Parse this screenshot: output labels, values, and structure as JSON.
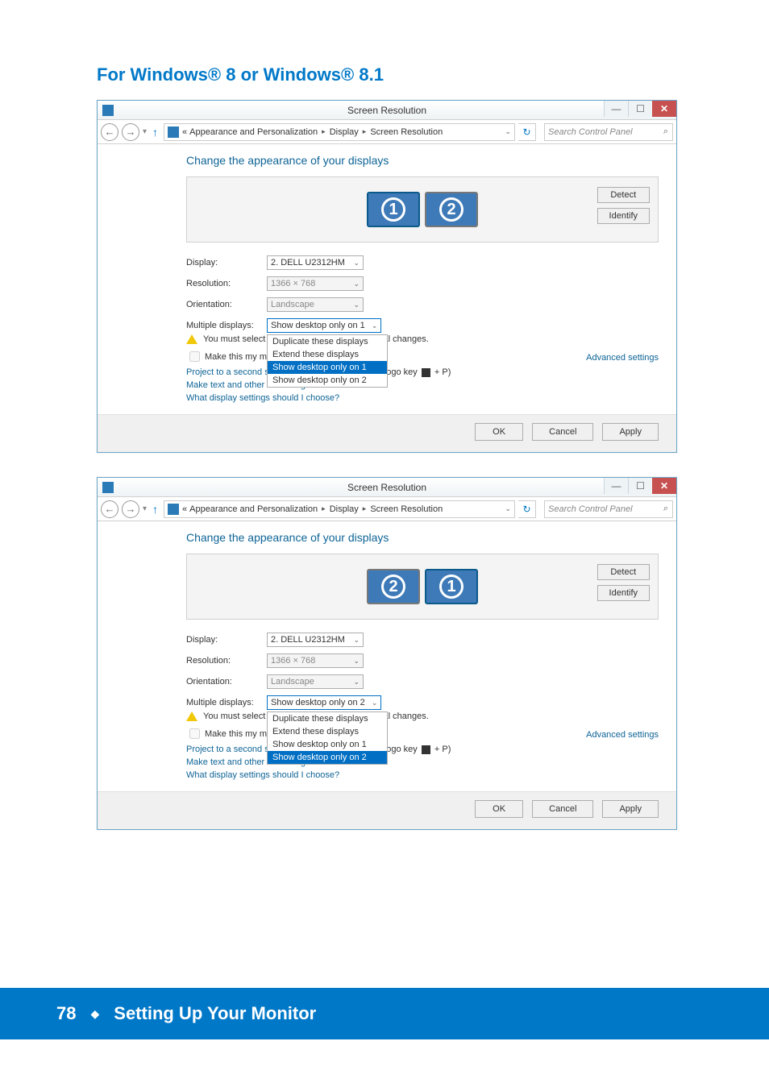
{
  "heading": "For Windows® 8 or Windows® 8.1",
  "footer": {
    "page": "78",
    "section": "Setting Up Your Monitor"
  },
  "common": {
    "title": "Screen Resolution",
    "breadcrumb": {
      "l1": "Appearance and Personalization",
      "l2": "Display",
      "l3": "Screen Resolution"
    },
    "search_placeholder": "Search Control Panel",
    "section_title": "Change the appearance of your displays",
    "detect": "Detect",
    "identify": "Identify",
    "labels": {
      "display": "Display:",
      "resolution": "Resolution:",
      "orientation": "Orientation:",
      "multiple": "Multiple displays:"
    },
    "values": {
      "display": "2. DELL U2312HM",
      "resolution": "1366 × 768",
      "orientation": "Landscape"
    },
    "warn_prefix": "You must select",
    "warn_suffix": "onal changes.",
    "make_main": "Make this my m",
    "advanced": "Advanced settings",
    "link1_a": "Project to a second screen",
    "link1_b": " (or press the Windows logo key ",
    "link1_c": " + P)",
    "link2": "Make text and other items larger or smaller",
    "link3": "What display settings should I choose?",
    "ok": "OK",
    "cancel": "Cancel",
    "apply": "Apply",
    "dd_opts": {
      "dup": "Duplicate these displays",
      "ext": "Extend these displays",
      "only1": "Show desktop only on 1",
      "only2": "Show desktop only on 2"
    }
  },
  "win1": {
    "multi_value": "Show desktop only on 1",
    "hl_option": "Show desktop only on 1",
    "monitor_order": [
      "1",
      "2"
    ]
  },
  "win2": {
    "multi_value": "Show desktop only on 2",
    "hl_option": "Show desktop only on 2",
    "monitor_order": [
      "2",
      "1"
    ]
  }
}
